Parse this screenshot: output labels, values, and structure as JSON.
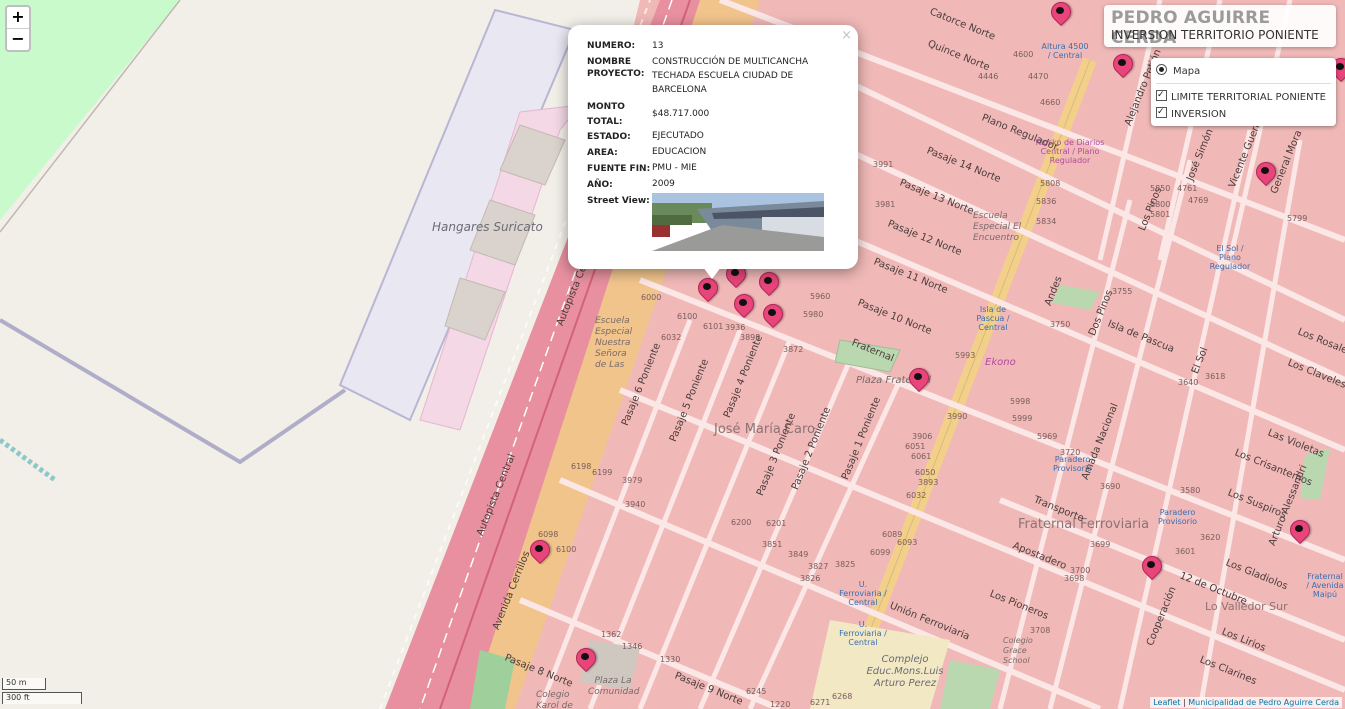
{
  "zoom": {
    "in_label": "+",
    "out_label": "−"
  },
  "title": {
    "main": "PEDRO AGUIRRE CERDA",
    "sub": "INVERSION TERRITORIO PONIENTE"
  },
  "layers": {
    "base": {
      "label": "Mapa",
      "selected": true
    },
    "overlays": [
      {
        "label": "LIMITE TERRITORIAL PONIENTE",
        "checked": true
      },
      {
        "label": "INVERSION",
        "checked": true
      }
    ]
  },
  "popup": {
    "close_label": "×",
    "fields": [
      {
        "key": "NUMERO:",
        "value": "13"
      },
      {
        "key": "NOMBRE PROYECTO:",
        "value": "CONSTRUCCIÓN DE MULTICANCHA TECHADA ESCUELA CIUDAD DE BARCELONA"
      },
      {
        "key": "MONTO TOTAL:",
        "value": "$48.717.000"
      },
      {
        "key": "ESTADO:",
        "value": "EJECUTADO"
      },
      {
        "key": "AREA:",
        "value": "EDUCACION"
      },
      {
        "key": "FUENTE FIN:",
        "value": "PMU - MIE"
      },
      {
        "key": "AÑO:",
        "value": "2009"
      },
      {
        "key": "Street View:",
        "value": ""
      }
    ]
  },
  "scale": {
    "metric": "50 m",
    "imperial": "300 ft"
  },
  "attribution": {
    "leaflet": "Leaflet",
    "sep": " | ",
    "source": "Municipalidad de Pedro Aguirre Cerda"
  },
  "map": {
    "airport_area": "Hangares Suricato",
    "places": [
      {
        "text": "José María Caro",
        "cls": "district"
      },
      {
        "text": "Fraternal Ferroviaria",
        "cls": "district"
      },
      {
        "text": "Plaza Fraternal",
        "cls": "place"
      },
      {
        "text": "Escuela Especial Nuestra Señora de Las",
        "cls": "place"
      },
      {
        "text": "Escuela Especial El Encuentro",
        "cls": "place"
      },
      {
        "text": "Complejo Educ.Mons.Luis Arturo Perez",
        "cls": "area-big"
      },
      {
        "text": "Colegio Karol de",
        "cls": "place"
      },
      {
        "text": "Colegio Grace School",
        "cls": "place"
      },
      {
        "text": "Plaza La Comunidad",
        "cls": "place"
      },
      {
        "text": "Lo Valledor Sur",
        "cls": "district"
      },
      {
        "text": "Ekono",
        "cls": "place"
      }
    ],
    "pois": [
      "Altura 4500 / Central",
      "Paradero Provisorio",
      "Paradero Provisorio",
      "El Sol / Plano Regulador",
      "Isla de Pascua / Central",
      "U. Ferroviaria / Central",
      "U. Ferroviaria / Central",
      "Kiosko de Diarios Central / Plano Regulador",
      "Fraternal / Avenida Maipú"
    ],
    "streets": [
      "Quince Norte",
      "Catorce Norte",
      "Plano Regulador",
      "Pasaje 14 Norte",
      "Pasaje 13 Norte",
      "Pasaje 12 Norte",
      "Pasaje 11 Norte",
      "Pasaje 10 Norte",
      "Fraternal",
      "Transporte",
      "Apostadero",
      "Unión Ferroviaria",
      "Los Pioneros",
      "Avenida Cerrillos",
      "Autopista Central",
      "Autopista Central",
      "Pasaje 6 Poniente",
      "Pasaje 5 Poniente",
      "Pasaje 4 Poniente",
      "Pasaje 3 Poniente",
      "Pasaje 2 Poniente",
      "Pasaje 1 Poniente",
      "Pasaje 8 Norte",
      "Pasaje 9 Norte",
      "Amada Nacional",
      "Isla de Pascua",
      "Dos Pinos",
      "Los Rosales",
      "Los Claveles",
      "Las Violetas",
      "Los Crisantemos",
      "Los Suspiros",
      "Los Gladiolos",
      "Los Lirios",
      "Los Clarines",
      "12 de Octubre",
      "Cooperación",
      "Arturo Alessandri",
      "Alejandro Petión",
      "José Simón",
      "Vicente Guerrero",
      "General Mora",
      "Andes",
      "El Sol",
      "Los Pinos"
    ],
    "numbers": [
      "4446",
      "4600",
      "4660",
      "4470",
      "3991",
      "3981",
      "5836",
      "5834",
      "5808",
      "6100",
      "6101",
      "3936",
      "3898",
      "3872",
      "6000",
      "6032",
      "5960",
      "5980",
      "5850",
      "5800",
      "4761",
      "5801",
      "4769",
      "5799",
      "3755",
      "3750",
      "3720",
      "3699",
      "3700",
      "3698",
      "3708",
      "3690",
      "3640",
      "3618",
      "3601",
      "3580",
      "3620",
      "6198",
      "6199",
      "6200",
      "6201",
      "3979",
      "3940",
      "3826",
      "3851",
      "3849",
      "3827",
      "3825",
      "6099",
      "6093",
      "6032",
      "6050",
      "6051",
      "5998",
      "6061",
      "6089",
      "5993",
      "5999",
      "5969",
      "3906",
      "3990",
      "3893",
      "6098",
      "6100",
      "1362",
      "1330",
      "1346",
      "6268",
      "1220",
      "6245",
      "6271"
    ]
  }
}
